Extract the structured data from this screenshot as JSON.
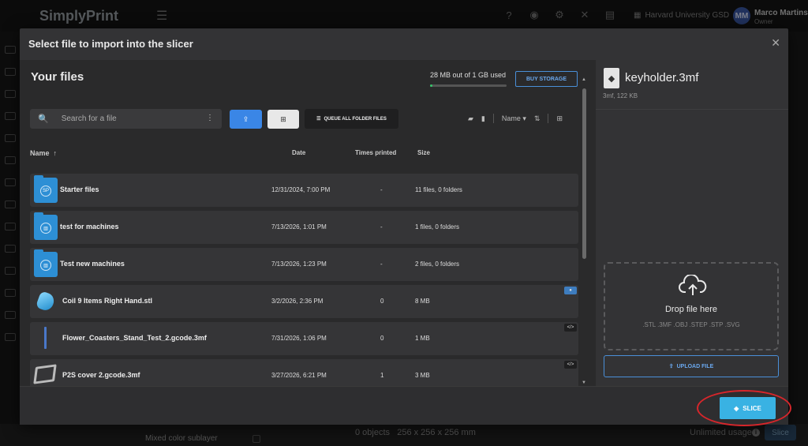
{
  "app": {
    "brand": "SimplyPrint",
    "menu_icon": "hamburger-icon",
    "organization": "Harvard University GSD",
    "user": {
      "initials": "MM",
      "name": "Marco Martins",
      "role": "Owner"
    },
    "top_icons": [
      "help-icon",
      "discord-icon",
      "settings-icon",
      "tools-icon",
      "news-icon",
      "building-icon"
    ]
  },
  "background": {
    "layer_label": "Mixed color sublayer",
    "objects": "0 objects",
    "dimensions": "256 x 256 x 256 mm",
    "usage": "Unlimited usage",
    "slice_label": "Slice"
  },
  "modal": {
    "title": "Select file to import into the slicer",
    "files": {
      "title": "Your files",
      "storage_text": "28 MB out of 1 GB used",
      "storage_used_fraction": 0.03,
      "buy_storage_label": "BUY STORAGE",
      "search_placeholder": "Search for a file",
      "queue_all_label": "QUEUE ALL FOLDER FILES",
      "sort_label": "Name",
      "columns": {
        "name": "Name",
        "date": "Date",
        "times_printed": "Times printed",
        "size": "Size"
      },
      "rows": [
        {
          "name": "Starter files",
          "date": "12/31/2024, 7:00 PM",
          "times": "-",
          "size": "11 files, 0 folders",
          "kind": "folder"
        },
        {
          "name": "test for machines",
          "date": "7/13/2026, 1:01 PM",
          "times": "-",
          "size": "1 files, 0 folders",
          "kind": "folder"
        },
        {
          "name": "Test new machines",
          "date": "7/13/2026, 1:23 PM",
          "times": "-",
          "size": "2 files, 0 folders",
          "kind": "folder"
        },
        {
          "name": "Coil 9 Items Right Hand.stl",
          "date": "3/2/2026, 2:36 PM",
          "times": "0",
          "size": "8 MB",
          "kind": "stl"
        },
        {
          "name": "Flower_Coasters_Stand_Test_2.gcode.3mf",
          "date": "7/31/2026, 1:06 PM",
          "times": "0",
          "size": "1 MB",
          "kind": "gcode"
        },
        {
          "name": "P2S cover 2.gcode.3mf",
          "date": "3/27/2026, 6:21 PM",
          "times": "1",
          "size": "3 MB",
          "kind": "gcode"
        }
      ]
    },
    "detail": {
      "file_name": "keyholder.3mf",
      "file_meta": "3mf, 122 KB",
      "drop_text": "Drop file here",
      "drop_types": ".STL .3MF .OBJ .STEP .STP .SVG",
      "upload_label": "UPLOAD FILE"
    },
    "slice_button": "SLICE"
  },
  "colors": {
    "accent_blue": "#3a86e6",
    "slice_cyan": "#39b2e3",
    "storage_green": "#35c46a",
    "highlight_red": "#d7262b"
  }
}
